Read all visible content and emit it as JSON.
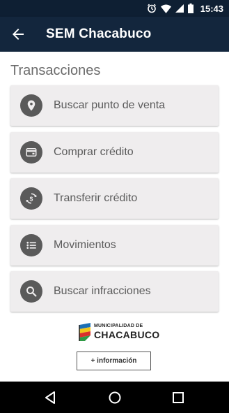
{
  "status_bar": {
    "time": "15:43",
    "icons": [
      "alarm-icon",
      "wifi-icon",
      "signal-icon",
      "battery-icon"
    ]
  },
  "app_bar": {
    "title": "SEM Chacabuco",
    "back_icon": "arrow-back-icon"
  },
  "section": {
    "title": "Transacciones"
  },
  "menu": {
    "items": [
      {
        "label": "Buscar punto de venta",
        "icon": "location-pin-icon"
      },
      {
        "label": "Comprar crédito",
        "icon": "wallet-icon"
      },
      {
        "label": "Transferir crédito",
        "icon": "transfer-icon"
      },
      {
        "label": "Movimientos",
        "icon": "list-icon"
      },
      {
        "label": "Buscar infracciones",
        "icon": "search-icon"
      }
    ]
  },
  "logo": {
    "line1": "MUNICIPALIDAD DE",
    "line2": "CHACABUCO"
  },
  "info_button": {
    "label": "+ información"
  },
  "colors": {
    "status_bar": "#0e1f33",
    "app_bar": "#13263d",
    "card_bg": "#efedee",
    "icon_circle": "#5a5a5a",
    "text_gray": "#5b5b5b"
  }
}
